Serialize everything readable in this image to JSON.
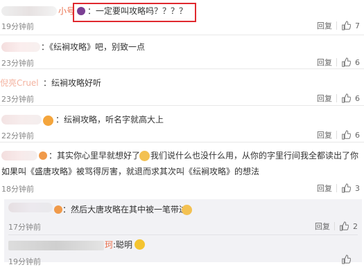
{
  "comments": [
    {
      "id": "c1",
      "prefix_visible": "小号",
      "text": "：一定要叫攻略吗？？？？",
      "time": "19分钟前",
      "reply": "回复",
      "likes": "7"
    },
    {
      "id": "c2",
      "text": "：《纭裥攻略》吧，别致一点",
      "time": "23分钟前",
      "reply": "回复",
      "likes": "6"
    },
    {
      "id": "c3",
      "prefix_visible": "倪亮Cruel",
      "text": "：纭裥攻略好听",
      "time": "23分钟前",
      "reply": "回复",
      "likes": "6"
    },
    {
      "id": "c4",
      "text": "：纭裥攻略，听名字就高大上",
      "time": "22分钟前",
      "reply": "回复",
      "likes": "6"
    },
    {
      "id": "c5",
      "text_line1a": "：其实你心里早就想好了",
      "text_line1b": "我们说什么也没什么用，从你的字里行间我全都读出了你",
      "text_line2": "如果叫《盛唐攻略》被骂得厉害，就退而求其次叫《纭裥攻略》的想法",
      "time": "18分钟前",
      "reply": "回复",
      "likes": "3"
    }
  ],
  "replies": [
    {
      "id": "r1",
      "text": "：然后大唐攻略在其中被一笔带过",
      "time": "17分钟前",
      "reply": "回复",
      "likes": "2"
    },
    {
      "id": "r2",
      "prefix_visible": "珂",
      "text": ":聪明",
      "time": "19分钟前",
      "reply": "",
      "likes": ""
    }
  ],
  "colors": {
    "name": "#eb7350",
    "highlight": "#e0282e",
    "time": "#888888"
  }
}
